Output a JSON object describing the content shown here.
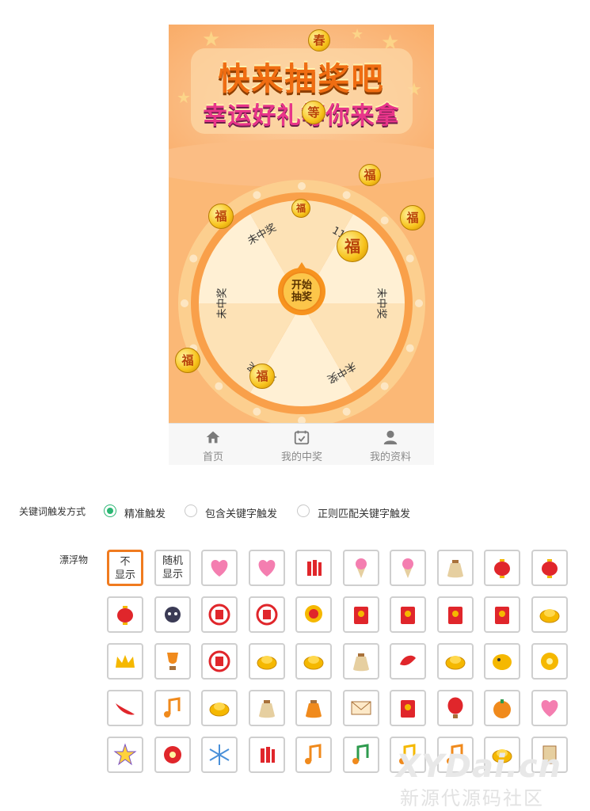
{
  "banner": {
    "title_line1": "快来抽奖吧",
    "title_line2": "幸运好礼等你来拿"
  },
  "wheel": {
    "segments": [
      "未中奖",
      "111",
      "未中奖",
      "未中奖",
      "未中奖",
      "未中奖"
    ],
    "start_button": "开始\n抽奖"
  },
  "tabbar": {
    "items": [
      {
        "label": "首页",
        "icon": "home-icon"
      },
      {
        "label": "我的中奖",
        "icon": "calendar-check-icon"
      },
      {
        "label": "我的资料",
        "icon": "user-icon"
      }
    ]
  },
  "trigger": {
    "label": "关键词触发方式",
    "options": [
      "精准触发",
      "包含关键字触发",
      "正则匹配关键字触发"
    ],
    "selected": "精准触发"
  },
  "floaters": {
    "label": "漂浮物",
    "text_options": [
      "不\n显示",
      "随机\n显示"
    ],
    "selected": "不显示",
    "icons": [
      "hearts-icon",
      "heart-balloon-icon",
      "firecracker-icon",
      "ice-cream-icon",
      "sundae-icon",
      "money-bag-icon",
      "lantern-icon",
      "red-lantern-icon",
      "small-lantern-icon",
      "cat-icon",
      "fu-seal-icon",
      "gold-fu-icon",
      "lion-dance-icon",
      "red-envelope-icon",
      "pink-envelope-icon",
      "fu-envelope-icon",
      "red-packet-icon",
      "gold-ingot-icon",
      "crown-icon",
      "trophy-icon",
      "paper-cut-icon",
      "coin-sack-icon",
      "gold-coin-icon",
      "dollar-bag-icon",
      "koi-fish-icon",
      "gold-nugget-icon",
      "piggy-bank-icon",
      "gold-flower-icon",
      "chili-icon",
      "banknote-icon",
      "coin-stack-icon",
      "paper-bag-icon",
      "orange-money-bag-icon",
      "letter-icon",
      "coupon-icon",
      "hot-air-balloon-icon",
      "tomato-icon",
      "winged-heart-icon",
      "star-icon",
      "red-flower-icon",
      "snowflake-icon",
      "firecracker-string-icon",
      "music-note-icon",
      "green-note-icon",
      "yellow-note-icon",
      "double-note-icon",
      "gold-boat-icon",
      "scroll-icon"
    ]
  },
  "watermark": {
    "line1": "XYDai.cn",
    "line2": "新源代源码社区"
  }
}
